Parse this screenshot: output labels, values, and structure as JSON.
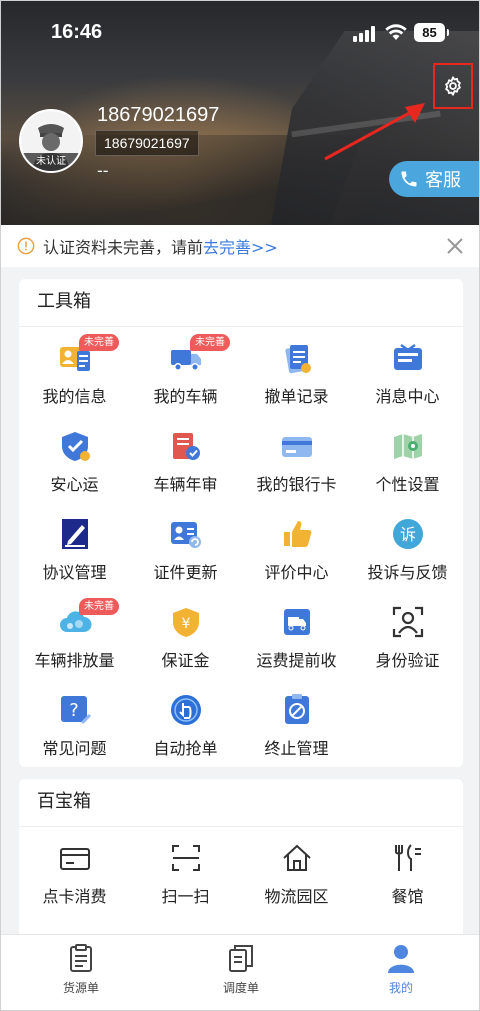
{
  "status_bar": {
    "time": "16:46",
    "battery": "85"
  },
  "profile": {
    "name": "18679021697",
    "phone": "18679021697",
    "extra": "--",
    "badge": "未认证",
    "service_label": "客服"
  },
  "notice": {
    "text": "认证资料未完善，请前",
    "link": "去完善>>"
  },
  "toolbox": {
    "title": "工具箱",
    "items": [
      {
        "label": "我的信息",
        "icon": "id-card-icon",
        "tag": "未完善"
      },
      {
        "label": "我的车辆",
        "icon": "truck-icon",
        "tag": "未完善"
      },
      {
        "label": "撤单记录",
        "icon": "clipboard-icon"
      },
      {
        "label": "消息中心",
        "icon": "message-icon"
      },
      {
        "label": "安心运",
        "icon": "shield-icon"
      },
      {
        "label": "车辆年审",
        "icon": "inspection-icon"
      },
      {
        "label": "我的银行卡",
        "icon": "bank-card-icon"
      },
      {
        "label": "个性设置",
        "icon": "map-settings-icon"
      },
      {
        "label": "协议管理",
        "icon": "document-pen-icon"
      },
      {
        "label": "证件更新",
        "icon": "certificate-icon"
      },
      {
        "label": "评价中心",
        "icon": "thumbs-up-icon"
      },
      {
        "label": "投诉与反馈",
        "icon": "complaint-icon"
      },
      {
        "label": "车辆排放量",
        "icon": "cloud-emission-icon",
        "tag": "未完善"
      },
      {
        "label": "保证金",
        "icon": "deposit-icon"
      },
      {
        "label": "运费提前收",
        "icon": "freight-icon"
      },
      {
        "label": "身份验证",
        "icon": "face-scan-icon"
      },
      {
        "label": "常见问题",
        "icon": "faq-icon"
      },
      {
        "label": "自动抢单",
        "icon": "auto-grab-icon"
      },
      {
        "label": "终止管理",
        "icon": "terminate-icon"
      }
    ]
  },
  "treasure": {
    "title": "百宝箱",
    "items": [
      {
        "label": "点卡消费",
        "icon": "card-icon"
      },
      {
        "label": "扫一扫",
        "icon": "scan-icon"
      },
      {
        "label": "物流园区",
        "icon": "home-icon"
      },
      {
        "label": "餐馆",
        "icon": "restaurant-icon"
      }
    ]
  },
  "tabbar": {
    "items": [
      {
        "label": "货源单",
        "icon": "clipboard-list-icon"
      },
      {
        "label": "调度单",
        "icon": "documents-icon"
      },
      {
        "label": "我的",
        "icon": "user-icon"
      }
    ]
  },
  "colors": {
    "accent": "#4f86e0",
    "tag_red": "#ef5a5a",
    "service_blue": "#4aa6dc",
    "highlight_red": "#e8271f"
  }
}
